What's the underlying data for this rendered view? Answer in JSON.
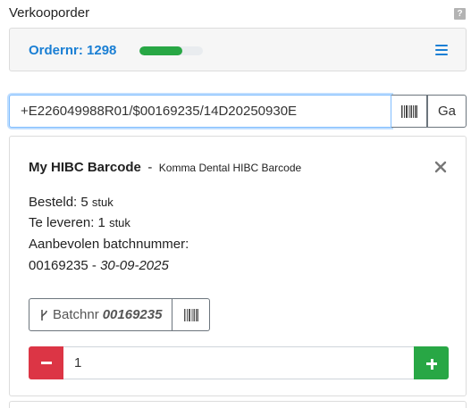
{
  "page": {
    "title": "Verkooporder",
    "help_label": "?"
  },
  "order": {
    "label": "Ordernr: 1298",
    "progress_fraction": 0.68,
    "colors": {
      "accent": "#1a7fd4",
      "progress": "#28a745"
    }
  },
  "scan": {
    "value": "+E226049988R01/$00169235/14D20250930E",
    "go_label": "Ga",
    "barcode_icon": "barcode-icon"
  },
  "item": {
    "title": "My HIBC Barcode",
    "separator": "-",
    "subtitle": "Komma Dental HIBC Barcode",
    "ordered_label": "Besteld:",
    "ordered_value": "5",
    "ordered_unit": "stuk",
    "deliver_label": "Te leveren:",
    "deliver_value": "1",
    "deliver_unit": "stuk",
    "recommended_label": "Aanbevolen batchnummer:",
    "recommended_batch": "00169235",
    "recommended_sep": "-",
    "recommended_date": "30-09-2025",
    "batch_button_label": "Batchnr",
    "batch_button_value": "00169235",
    "quantity": "1",
    "colors": {
      "minus": "#dc3545",
      "plus": "#28a745"
    }
  }
}
